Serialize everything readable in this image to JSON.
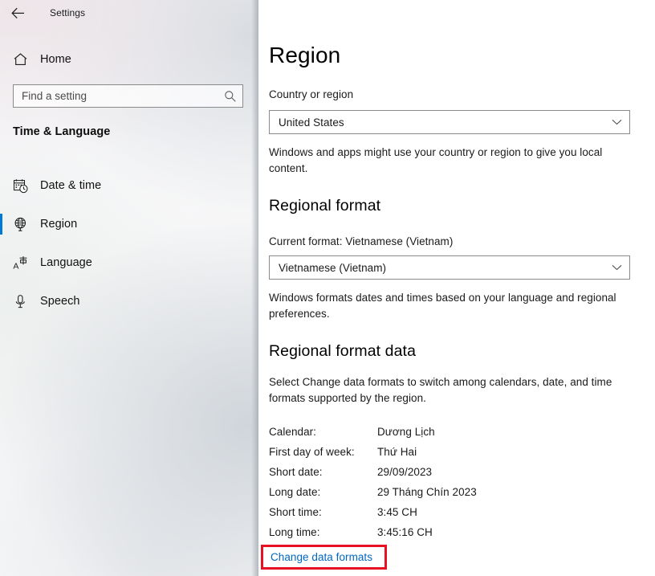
{
  "window": {
    "back_label": "back-arrow",
    "title": "Settings"
  },
  "sidebar": {
    "home_label": "Home",
    "search": {
      "placeholder": "Find a setting",
      "value": "",
      "icon": "search-icon"
    },
    "group_header": "Time & Language",
    "selected_accent": "#0078d4",
    "items": [
      {
        "label": "Date & time",
        "icon": "calendar-clock-icon",
        "selected": false
      },
      {
        "label": "Region",
        "icon": "globe-icon",
        "selected": true
      },
      {
        "label": "Language",
        "icon": "language-icon",
        "selected": false
      },
      {
        "label": "Speech",
        "icon": "microphone-icon",
        "selected": false
      }
    ]
  },
  "main": {
    "title": "Region",
    "country": {
      "label": "Country or region",
      "value": "United States",
      "description": "Windows and apps might use your country or region to give you local content.",
      "arrow_icon": "chevron-down-icon"
    },
    "regional_format": {
      "heading": "Regional format",
      "current_format": "Current format: Vietnamese (Vietnam)",
      "value": "Vietnamese (Vietnam)",
      "description": "Windows formats dates and times based on your language and regional preferences.",
      "arrow_icon": "chevron-down-icon"
    },
    "regional_format_data": {
      "heading": "Regional format data",
      "description": "Select Change data formats to switch among calendars, date, and time formats supported by the region.",
      "rows": [
        {
          "key": "Calendar:",
          "value": "Dương Lịch"
        },
        {
          "key": "First day of week:",
          "value": "Thứ Hai"
        },
        {
          "key": "Short date:",
          "value": "29/09/2023"
        },
        {
          "key": "Long date:",
          "value": "29 Tháng Chín 2023"
        },
        {
          "key": "Short time:",
          "value": "3:45 CH"
        },
        {
          "key": "Long time:",
          "value": "3:45:16 CH"
        }
      ],
      "link_label": "Change data formats",
      "link_color": "#0067c0",
      "highlight_color": "#e81123"
    }
  }
}
